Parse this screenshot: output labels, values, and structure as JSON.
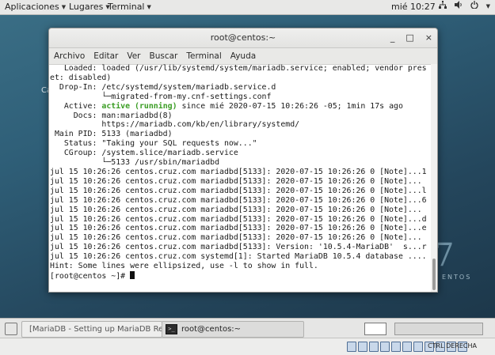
{
  "topbar": {
    "applications": "Aplicaciones",
    "places": "Lugares",
    "terminal": "Terminal",
    "clock": "mié 10:27"
  },
  "desktop": {
    "partial_text_left": "Ca",
    "brand_partial": "ENTOS",
    "brand_seven": "7"
  },
  "window": {
    "title": "root@centos:~",
    "minimize": "_",
    "maximize": "□",
    "close": "×",
    "menu": [
      "Archivo",
      "Editar",
      "Ver",
      "Buscar",
      "Terminal",
      "Ayuda"
    ]
  },
  "terminal": {
    "lines": [
      "   Loaded: loaded (/usr/lib/systemd/system/mariadb.service; enabled; vendor pres",
      "et: disabled)",
      "  Drop-In: /etc/systemd/system/mariadb.service.d",
      "           └─migrated-from-my.cnf-settings.conf",
      "   Active: ",
      "     Docs: man:mariadbd(8)",
      "           https://mariadb.com/kb/en/library/systemd/",
      " Main PID: 5133 (mariadbd)",
      "   Status: \"Taking your SQL requests now...\"",
      "   CGroup: /system.slice/mariadb.service",
      "           └─5133 /usr/sbin/mariadbd",
      "",
      "jul 15 10:26:26 centos.cruz.com mariadbd[5133]: 2020-07-15 10:26:26 0 [Note]...1",
      "jul 15 10:26:26 centos.cruz.com mariadbd[5133]: 2020-07-15 10:26:26 0 [Note]...",
      "jul 15 10:26:26 centos.cruz.com mariadbd[5133]: 2020-07-15 10:26:26 0 [Note]...l",
      "jul 15 10:26:26 centos.cruz.com mariadbd[5133]: 2020-07-15 10:26:26 0 [Note]...6",
      "jul 15 10:26:26 centos.cruz.com mariadbd[5133]: 2020-07-15 10:26:26 0 [Note]...",
      "jul 15 10:26:26 centos.cruz.com mariadbd[5133]: 2020-07-15 10:26:26 0 [Note]...d",
      "jul 15 10:26:26 centos.cruz.com mariadbd[5133]: 2020-07-15 10:26:26 0 [Note]...e",
      "jul 15 10:26:26 centos.cruz.com mariadbd[5133]: 2020-07-15 10:26:26 0 [Note]...",
      "jul 15 10:26:26 centos.cruz.com mariadbd[5133]: Version: '10.5.4-MariaDB'  s...r",
      "jul 15 10:26:26 centos.cruz.com systemd[1]: Started MariaDB 10.5.4 database ....",
      "Hint: Some lines were ellipsized, use -l to show in full.",
      "[root@centos ~]# "
    ],
    "active_status": "active (running)",
    "active_rest": " since mié 2020-07-15 10:26:26 -05; 1min 17s ago"
  },
  "taskbar": {
    "task1": "[MariaDB - Setting up MariaDB Repo...",
    "task2": "root@centos:~"
  },
  "vbox": {
    "host_key": "CTRL DERECHA"
  }
}
